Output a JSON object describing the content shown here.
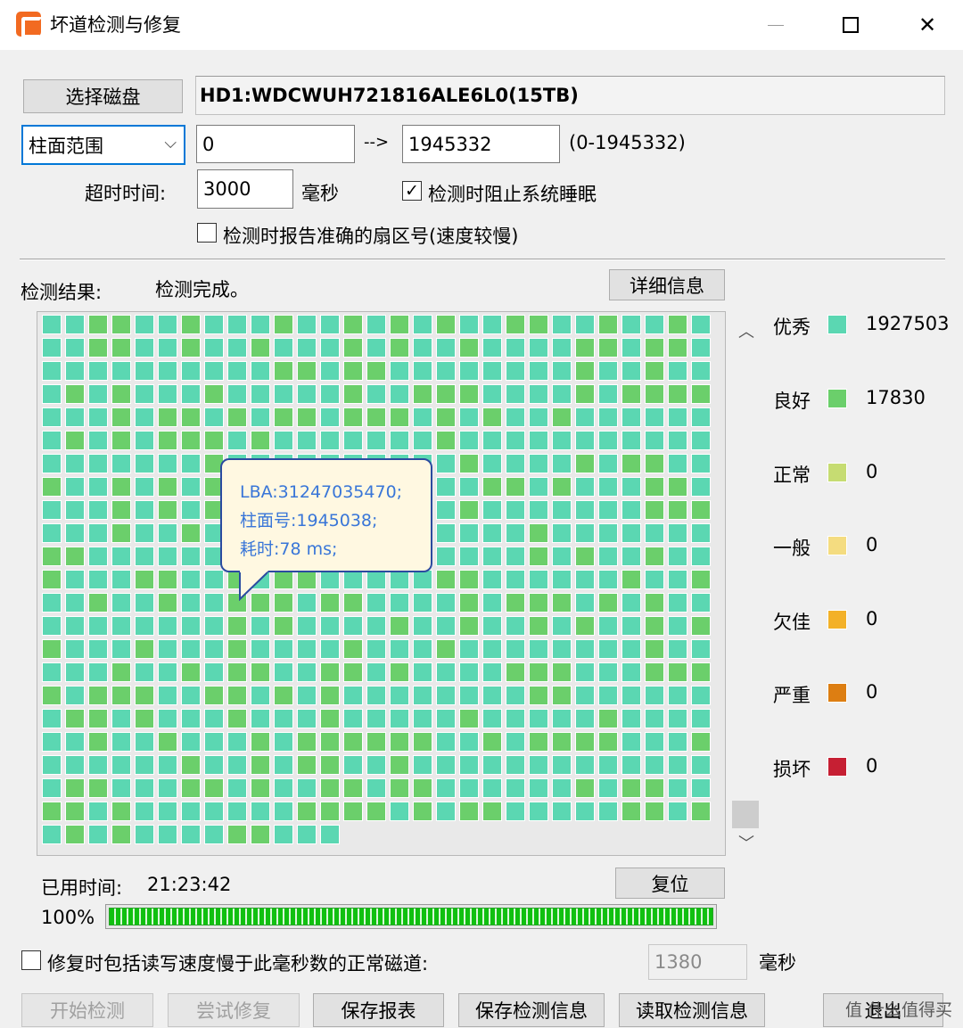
{
  "window": {
    "title": "坏道检测与修复",
    "controls": {
      "minimize": "—",
      "maximize": "☐",
      "close": "✕"
    }
  },
  "disk": {
    "select_button": "选择磁盘",
    "name": "HD1:WDCWUH721816ALE6L0(15TB)"
  },
  "range": {
    "mode": "柱面范围",
    "start": "0",
    "arrow": "-->",
    "end": "1945332",
    "hint": "(0-1945332)"
  },
  "timeout": {
    "label": "超时时间:",
    "value": "3000",
    "unit": "毫秒"
  },
  "options": {
    "prevent_sleep": {
      "label": "检测时阻止系统睡眠",
      "checked": true
    },
    "report_sector": {
      "label": "检测时报告准确的扇区号(速度较慢)",
      "checked": false
    }
  },
  "result": {
    "label": "检测结果:",
    "status": "检测完成。",
    "detail_button": "详细信息"
  },
  "tooltip": {
    "lba": "LBA:31247035470;",
    "cylinder": "柱面号:1945038;",
    "time": "耗时:78 ms;"
  },
  "grid": {
    "columns": 29,
    "full_rows": 22,
    "last_row_cells": 13,
    "colors": {
      "excellent": "#5bd7b2",
      "good": "#6bcf6b"
    }
  },
  "legend": [
    {
      "name": "优秀",
      "value": "1927503",
      "color": "#5bd7b2"
    },
    {
      "name": "良好",
      "value": "17830",
      "color": "#6bcf6b"
    },
    {
      "name": "正常",
      "value": "0",
      "color": "#c6dc72"
    },
    {
      "name": "一般",
      "value": "0",
      "color": "#f4dc80"
    },
    {
      "name": "欠佳",
      "value": "0",
      "color": "#f3b128"
    },
    {
      "name": "严重",
      "value": "0",
      "color": "#dd7e12"
    },
    {
      "name": "损坏",
      "value": "0",
      "color": "#c61f33"
    }
  ],
  "elapsed": {
    "label": "已用时间:",
    "value": "21:23:42",
    "reset_button": "复位"
  },
  "progress": {
    "label": "100%",
    "value": 1.0
  },
  "repair_option": {
    "label": "修复时包括读写速度慢于此毫秒数的正常磁道:",
    "checked": false,
    "value": "1380",
    "unit": "毫秒"
  },
  "actions": {
    "start": "开始检测",
    "try_repair": "尝试修复",
    "save_report": "保存报表",
    "save_info": "保存检测信息",
    "load_info": "读取检测信息",
    "exit": "退出"
  },
  "watermark": "值 什么值得买",
  "icons": {
    "app": "app-logo-icon",
    "dropdown": "chevron-down-icon",
    "scroll_up": "chevron-up-icon",
    "scroll_down": "chevron-down-icon"
  }
}
